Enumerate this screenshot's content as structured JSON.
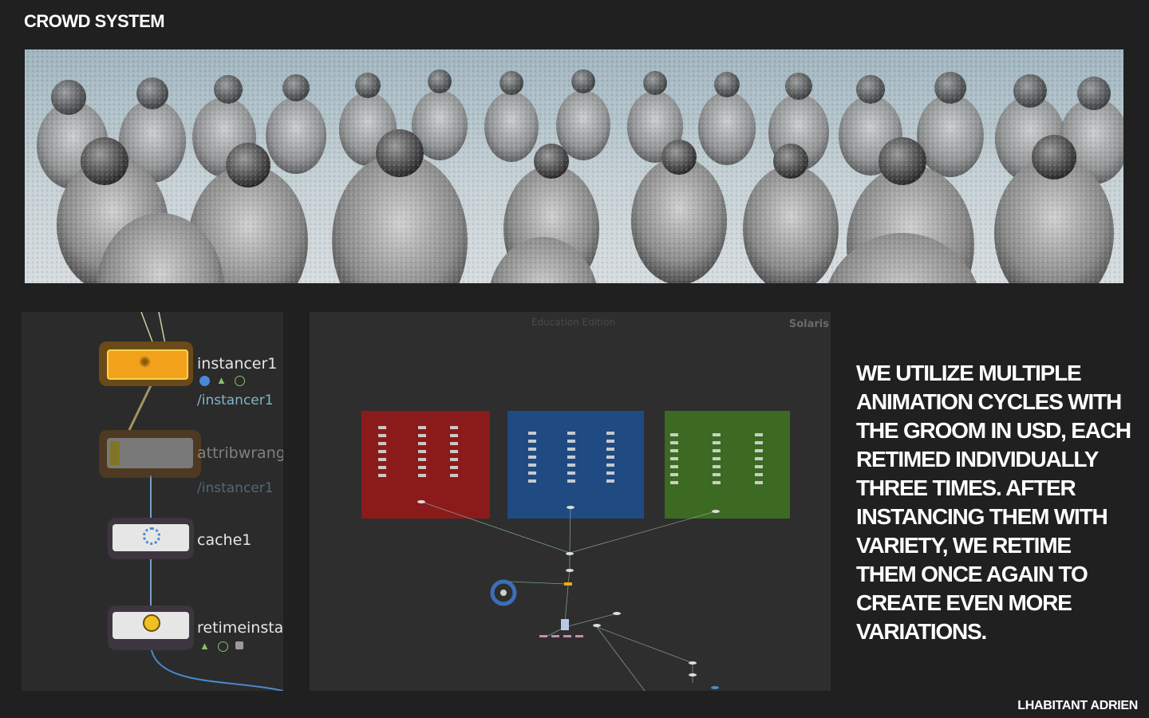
{
  "header": {
    "title": "CROWD SYSTEM"
  },
  "node_graph": {
    "nodes": [
      {
        "label": "instancer1",
        "path": "/instancer1"
      },
      {
        "label": "attribwrang",
        "path": "/instancer1"
      },
      {
        "label": "cache1"
      },
      {
        "label": "retimeinstai"
      }
    ]
  },
  "solaris_view": {
    "watermark": "Education Edition",
    "context_label": "Solaris"
  },
  "description": "WE UTILIZE MULTIPLE ANIMATION CYCLES WITH THE GROOM IN USD, EACH RETIMED INDIVIDUALLY THREE TIMES. AFTER INSTANCING THEM WITH VARIETY, WE RETIME THEM ONCE AGAIN TO CREATE EVEN MORE VARIATIONS.",
  "footer": {
    "credit": "LHABITANT ADRIEN"
  },
  "colors": {
    "background": "#202020",
    "red_box": "#8b1a1a",
    "blue_box": "#1f4a82",
    "green_box": "#3d6a22",
    "node_selected": "#f2a21a"
  }
}
